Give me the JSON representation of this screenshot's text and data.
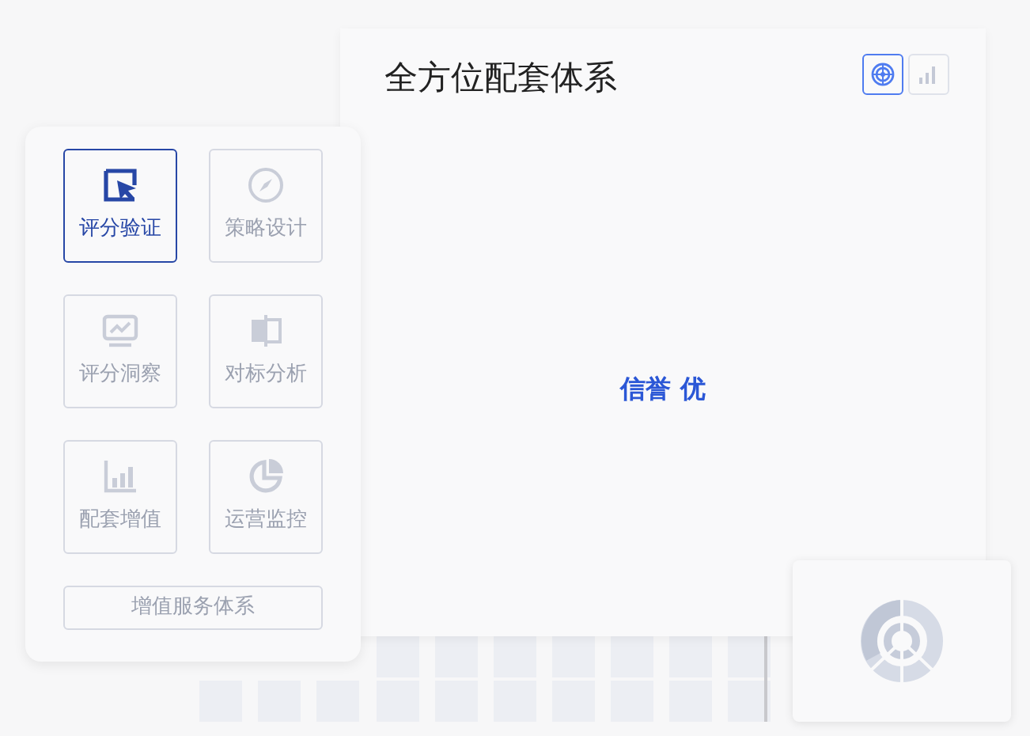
{
  "main_panel": {
    "title": "全方位配套体系",
    "view_toggles": [
      {
        "kind": "radar",
        "selected": true
      },
      {
        "kind": "bars",
        "selected": false
      }
    ],
    "center_text": "信誉 优"
  },
  "menu": {
    "items": [
      {
        "label": "评分验证",
        "kind": "cursor",
        "selected": true
      },
      {
        "label": "策略设计",
        "kind": "compass",
        "selected": false
      },
      {
        "label": "评分洞察",
        "kind": "monitor",
        "selected": false
      },
      {
        "label": "对标分析",
        "kind": "compare",
        "selected": false
      },
      {
        "label": "配套增值",
        "kind": "barchart",
        "selected": false
      },
      {
        "label": "运营监控",
        "kind": "pie",
        "selected": false
      }
    ],
    "footer_button": "增值服务体系"
  }
}
